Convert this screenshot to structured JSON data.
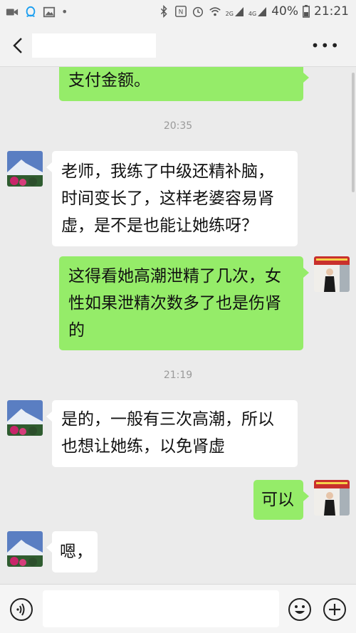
{
  "status": {
    "battery": "40%",
    "time": "21:21",
    "net1": "2G",
    "net2": "4G"
  },
  "header": {
    "title": ""
  },
  "messages": [
    {
      "side": "out",
      "text": "支付金额。"
    },
    {
      "time": "20:35"
    },
    {
      "side": "in",
      "lines": [
        "老师，我练了中级还精补脑，",
        "时间变长了，这样老婆容易肾",
        "虚，是不是也能让她练呀？"
      ]
    },
    {
      "side": "out",
      "lines": [
        "这得看她高潮泄精了几次，女",
        "性如果泄精次数多了也是伤肾",
        "的"
      ]
    },
    {
      "time": "21:19"
    },
    {
      "side": "in",
      "lines": [
        "是的，一般有三次高潮，所以",
        "也想让她练，以免肾虚"
      ]
    },
    {
      "side": "out",
      "text": "可以"
    },
    {
      "side": "in",
      "text": "嗯，"
    }
  ],
  "input": {
    "value": ""
  },
  "colors": {
    "out_bubble": "#95ec69",
    "in_bubble": "#ffffff",
    "background": "#ebebeb"
  }
}
